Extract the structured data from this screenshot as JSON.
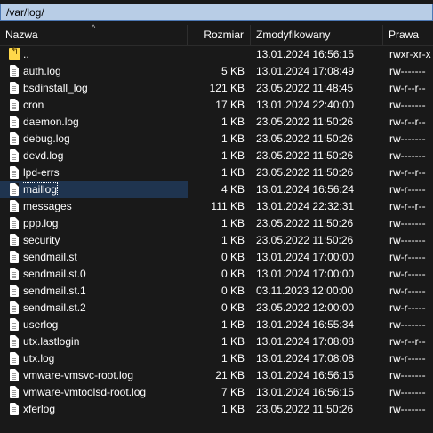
{
  "path": "/var/log/",
  "columns": {
    "name": "Nazwa",
    "size": "Rozmiar",
    "modified": "Zmodyfikowany",
    "perms": "Prawa",
    "sort_indicator": "^"
  },
  "files": [
    {
      "name": "..",
      "size": "",
      "modified": "13.01.2024 16:56:15",
      "perms": "rwxr-xr-x",
      "icon": "parent-folder-icon"
    },
    {
      "name": "auth.log",
      "size": "5 KB",
      "modified": "13.01.2024 17:08:49",
      "perms": "rw-------",
      "icon": "file-icon"
    },
    {
      "name": "bsdinstall_log",
      "size": "121 KB",
      "modified": "23.05.2022 11:48:45",
      "perms": "rw-r--r--",
      "icon": "file-icon"
    },
    {
      "name": "cron",
      "size": "17 KB",
      "modified": "13.01.2024 22:40:00",
      "perms": "rw-------",
      "icon": "file-icon"
    },
    {
      "name": "daemon.log",
      "size": "1 KB",
      "modified": "23.05.2022 11:50:26",
      "perms": "rw-r--r--",
      "icon": "file-icon"
    },
    {
      "name": "debug.log",
      "size": "1 KB",
      "modified": "23.05.2022 11:50:26",
      "perms": "rw-------",
      "icon": "file-icon"
    },
    {
      "name": "devd.log",
      "size": "1 KB",
      "modified": "23.05.2022 11:50:26",
      "perms": "rw-------",
      "icon": "file-icon"
    },
    {
      "name": "lpd-errs",
      "size": "1 KB",
      "modified": "23.05.2022 11:50:26",
      "perms": "rw-r--r--",
      "icon": "file-icon"
    },
    {
      "name": "maillog",
      "size": "4 KB",
      "modified": "13.01.2024 16:56:24",
      "perms": "rw-r-----",
      "icon": "file-icon",
      "selected": true
    },
    {
      "name": "messages",
      "size": "111 KB",
      "modified": "13.01.2024 22:32:31",
      "perms": "rw-r--r--",
      "icon": "file-icon"
    },
    {
      "name": "ppp.log",
      "size": "1 KB",
      "modified": "23.05.2022 11:50:26",
      "perms": "rw-------",
      "icon": "file-icon"
    },
    {
      "name": "security",
      "size": "1 KB",
      "modified": "23.05.2022 11:50:26",
      "perms": "rw-------",
      "icon": "file-icon"
    },
    {
      "name": "sendmail.st",
      "size": "0 KB",
      "modified": "13.01.2024 17:00:00",
      "perms": "rw-r-----",
      "icon": "file-icon"
    },
    {
      "name": "sendmail.st.0",
      "size": "0 KB",
      "modified": "13.01.2024 17:00:00",
      "perms": "rw-r-----",
      "icon": "file-icon"
    },
    {
      "name": "sendmail.st.1",
      "size": "0 KB",
      "modified": "03.11.2023 12:00:00",
      "perms": "rw-r-----",
      "icon": "file-icon"
    },
    {
      "name": "sendmail.st.2",
      "size": "0 KB",
      "modified": "23.05.2022 12:00:00",
      "perms": "rw-r-----",
      "icon": "file-icon"
    },
    {
      "name": "userlog",
      "size": "1 KB",
      "modified": "13.01.2024 16:55:34",
      "perms": "rw-------",
      "icon": "file-icon"
    },
    {
      "name": "utx.lastlogin",
      "size": "1 KB",
      "modified": "13.01.2024 17:08:08",
      "perms": "rw-r--r--",
      "icon": "file-icon"
    },
    {
      "name": "utx.log",
      "size": "1 KB",
      "modified": "13.01.2024 17:08:08",
      "perms": "rw-r-----",
      "icon": "file-icon"
    },
    {
      "name": "vmware-vmsvc-root.log",
      "size": "21 KB",
      "modified": "13.01.2024 16:56:15",
      "perms": "rw-------",
      "icon": "file-icon"
    },
    {
      "name": "vmware-vmtoolsd-root.log",
      "size": "7 KB",
      "modified": "13.01.2024 16:56:15",
      "perms": "rw-------",
      "icon": "file-icon"
    },
    {
      "name": "xferlog",
      "size": "1 KB",
      "modified": "23.05.2022 11:50:26",
      "perms": "rw-------",
      "icon": "file-icon"
    }
  ],
  "colors": {
    "background": "#191919",
    "path_bar": "#b8cde6",
    "selection": "#1f344f",
    "parent_icon": "#ffd84a"
  }
}
